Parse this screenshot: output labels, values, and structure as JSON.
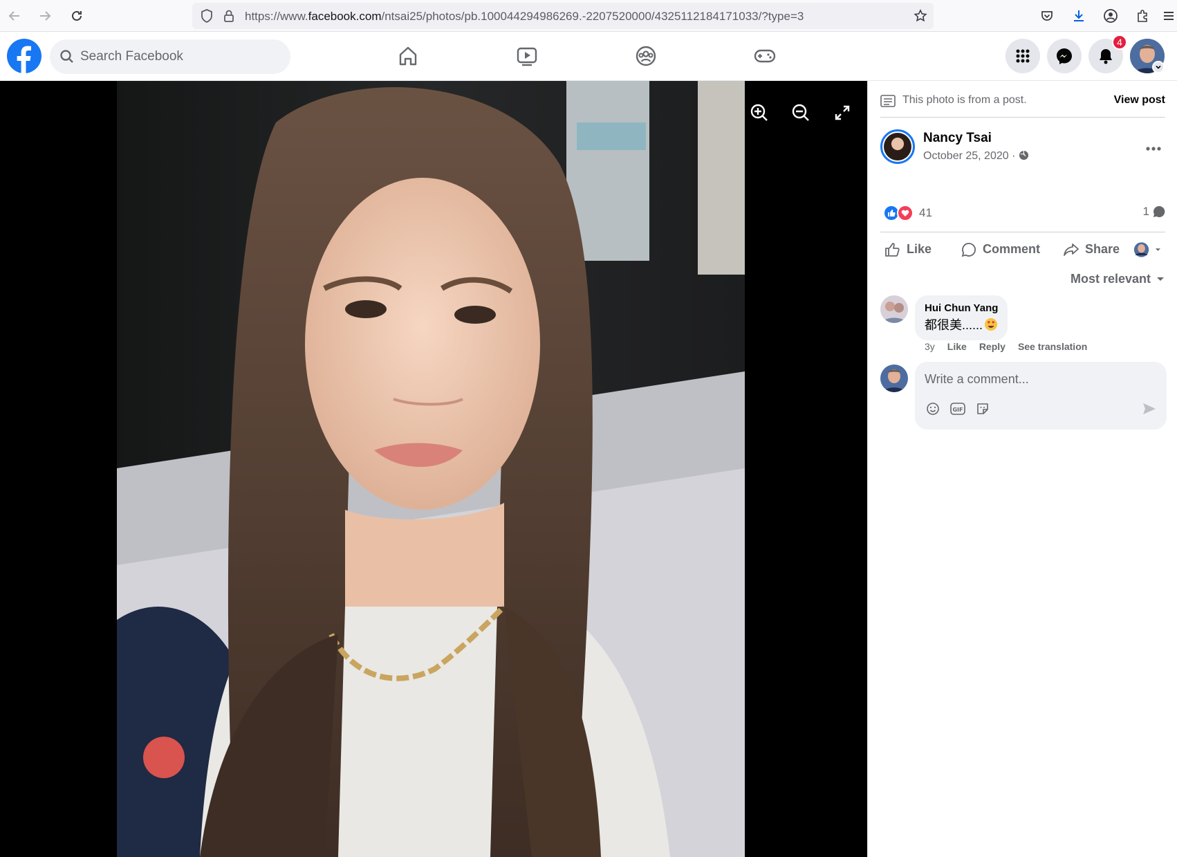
{
  "browser": {
    "url_prefix": "https://www.",
    "url_domain": "facebook.com",
    "url_path": "/ntsai25/photos/pb.100044294986269.-2207520000/4325112184171033/?type=3"
  },
  "fb_nav": {
    "search_placeholder": "Search Facebook",
    "notification_count": "4"
  },
  "panel": {
    "from_post_text": "This photo is from a post.",
    "view_post_label": "View post",
    "author_name": "Nancy Tsai",
    "post_date": "October 25, 2020 ·",
    "reaction_count": "41",
    "comment_count": "1",
    "actions": {
      "like": "Like",
      "comment": "Comment",
      "share": "Share"
    },
    "sort_label": "Most relevant",
    "comment": {
      "author": "Hui Chun Yang",
      "text": "都很美......",
      "age": "3y",
      "like": "Like",
      "reply": "Reply",
      "translate": "See translation"
    },
    "write_placeholder": "Write a comment..."
  },
  "colors": {
    "brand": "#1877f2",
    "badge": "#e41e3f",
    "love": "#f33e58"
  }
}
